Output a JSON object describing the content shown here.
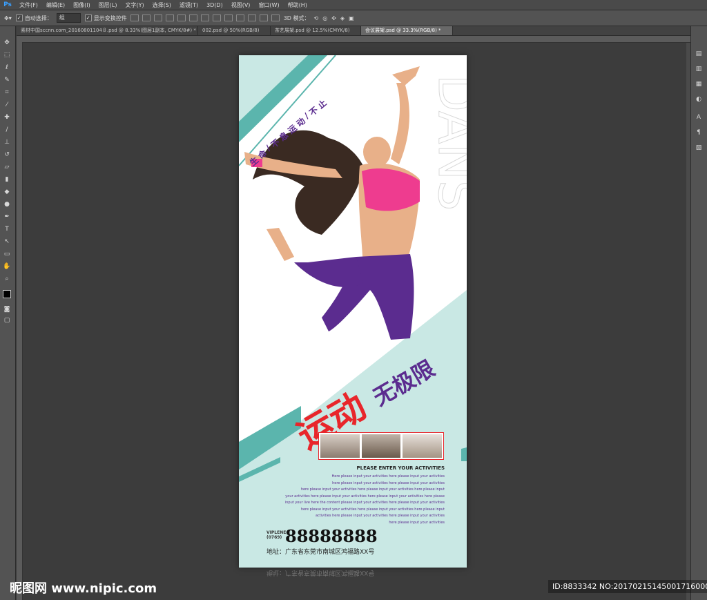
{
  "app": {
    "logo": "Ps"
  },
  "menu": [
    "文件(F)",
    "编辑(E)",
    "图像(I)",
    "图层(L)",
    "文字(Y)",
    "选择(S)",
    "滤镜(T)",
    "3D(D)",
    "视图(V)",
    "窗口(W)",
    "帮助(H)"
  ],
  "options": {
    "auto_select_label": "自动选择：",
    "auto_select_value": "组",
    "transform_label": "显示变换控件",
    "mode_3d": "3D 模式："
  },
  "tabs": [
    {
      "label": "素材中国sccnn.com_20160801104８.psd @ 8.33%(图层1副本, CMYK/8#) *",
      "active": false
    },
    {
      "label": "002.psd @ 50%(RGB/8)",
      "active": false
    },
    {
      "label": "茶艺展架.psd @ 12.5%(CMYK/8)",
      "active": false
    },
    {
      "label": "会议展架.psd @ 33.3%(RGB/8) *",
      "active": true
    }
  ],
  "poster": {
    "slogan_vertical": [
      "生",
      "命",
      "/",
      "不",
      "息",
      "运",
      "动",
      "/",
      "不",
      "止"
    ],
    "big_word": "DANS",
    "title_red": "运动",
    "title_purple": "无极限",
    "heading": "PLEASE ENTER YOUR ACTIVITIES",
    "body_lines": [
      "Here please input your activities here please input your activities",
      "here please input your activities here please input your activities",
      "here please input your activities here please input your activities here please input",
      "your activities here please input your activities here please input your activities here please",
      "input your live here the content please input your activities here please input your activities",
      "here please input your activities here please input your activities here please input",
      "activities here please input your activities here please input your activities",
      "here please input your activities"
    ],
    "phone_label_1": "VIPLENE",
    "phone_label_2": "(0769)",
    "phone": "88888888",
    "address": "地址：广东省东莞市南城区鸿福路XX号",
    "colors": {
      "teal": "#5bb5ad",
      "light_teal": "#c9e8e4",
      "red": "#e8262b",
      "purple": "#5b2c8f",
      "pink": "#ee3c8f",
      "skin": "#e8b089"
    }
  },
  "watermark": "昵图网 www.nipic.com",
  "image_id": "ID:8833342 NO:20170215145001716000"
}
